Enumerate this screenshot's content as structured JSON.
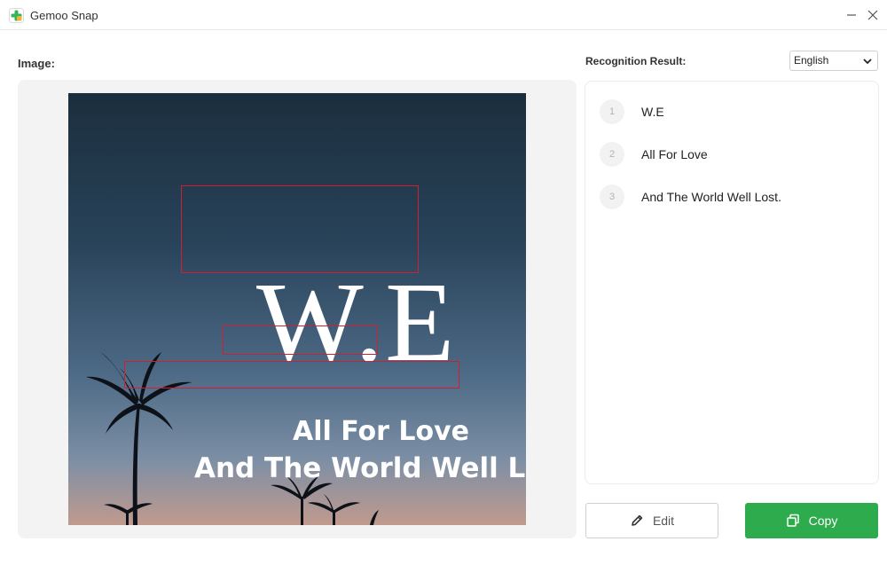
{
  "window": {
    "title": "Gemoo Snap",
    "controls": {
      "minimize": "minimize-icon",
      "close": "close-icon"
    }
  },
  "image_section": {
    "label": "Image:",
    "detected_texts": [
      "W.E",
      "All For Love",
      "And The World Well Lost."
    ],
    "highlight_color": "#d0202f"
  },
  "result_section": {
    "label": "Recognition Result:",
    "language": {
      "selected": "English",
      "icon": "chevron-down-icon"
    },
    "items": [
      {
        "number": "1",
        "text": "W.E"
      },
      {
        "number": "2",
        "text": "All For Love"
      },
      {
        "number": "3",
        "text": "And The World Well Lost."
      }
    ]
  },
  "actions": {
    "edit": {
      "label": "Edit",
      "icon": "pencil-icon"
    },
    "copy": {
      "label": "Copy",
      "icon": "copy-icon",
      "color": "#2eac4d"
    }
  }
}
